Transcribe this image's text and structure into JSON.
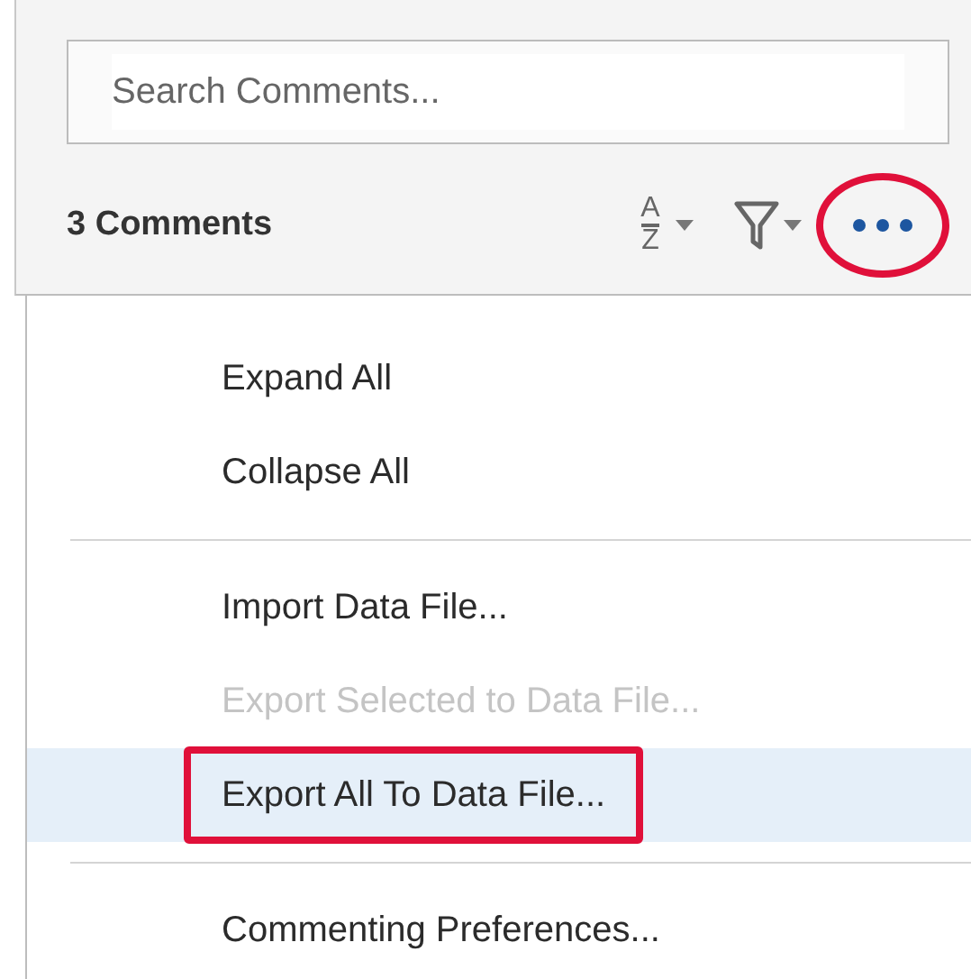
{
  "search": {
    "placeholder": "Search Comments..."
  },
  "toolbar": {
    "count_label": "3 Comments",
    "sort_button": {
      "icon_letters": [
        "A",
        "Z"
      ]
    },
    "more_button": {
      "circled": true
    }
  },
  "menu": {
    "items": [
      {
        "kind": "item",
        "label": "Expand All",
        "disabled": false,
        "selected": false,
        "boxed": false
      },
      {
        "kind": "item",
        "label": "Collapse All",
        "disabled": false,
        "selected": false,
        "boxed": false
      },
      {
        "kind": "separator"
      },
      {
        "kind": "item",
        "label": "Import Data File...",
        "disabled": false,
        "selected": false,
        "boxed": false
      },
      {
        "kind": "item",
        "label": "Export Selected to Data File...",
        "disabled": true,
        "selected": false,
        "boxed": false
      },
      {
        "kind": "item",
        "label": "Export All To Data File...",
        "disabled": false,
        "selected": true,
        "boxed": true
      },
      {
        "kind": "separator"
      },
      {
        "kind": "item",
        "label": "Commenting Preferences...",
        "disabled": false,
        "selected": false,
        "boxed": false
      }
    ]
  }
}
